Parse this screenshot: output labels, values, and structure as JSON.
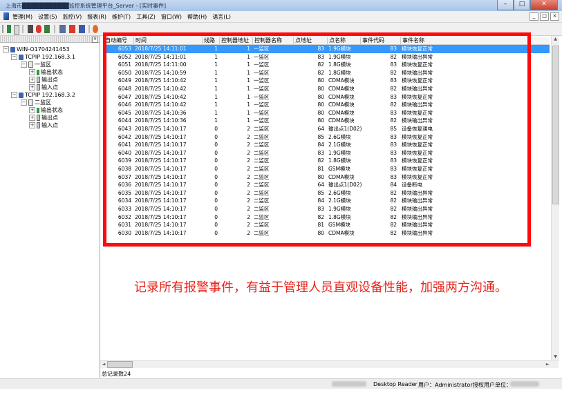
{
  "window": {
    "title": "上海市███████████监控系统管理平台_Server - [实时事件]",
    "btn_min": "–",
    "btn_max": "□",
    "btn_close": "✕"
  },
  "menu": [
    "管理(M)",
    "设置(S)",
    "监控(V)",
    "报表(R)",
    "维护(T)",
    "工具(Z)",
    "窗口(W)",
    "帮助(H)",
    "语言(L)"
  ],
  "mdi_buttons": [
    "_",
    "□",
    "×"
  ],
  "tree": {
    "root": "WIN-O1704241453",
    "groups": [
      {
        "ip": "TCPIP 192.168.3.1",
        "area": "一监区",
        "items": [
          "输出状态",
          "输出点",
          "输入点"
        ]
      },
      {
        "ip": "TCPIP 192.168.3.2",
        "area": "二监区",
        "items": [
          "输出状态",
          "输出点",
          "输入点"
        ]
      }
    ]
  },
  "table": {
    "columns": [
      "自动编号",
      "时间",
      "线路",
      "控制器地址",
      "控制器名称",
      "点地址",
      "点名称",
      "事件代码",
      "事件名称"
    ],
    "rows": [
      [
        "6053",
        "2018/7/25 14:11:01",
        "1",
        "1",
        "一监区",
        "83",
        "1.9G模块",
        "83",
        "模块恢复正常"
      ],
      [
        "6052",
        "2018/7/25 14:11:01",
        "1",
        "1",
        "一监区",
        "83",
        "1.9G模块",
        "82",
        "模块输出异常"
      ],
      [
        "6051",
        "2018/7/25 14:11:00",
        "1",
        "1",
        "一监区",
        "82",
        "1.8G模块",
        "83",
        "模块恢复正常"
      ],
      [
        "6050",
        "2018/7/25 14:10:59",
        "1",
        "1",
        "一监区",
        "82",
        "1.8G模块",
        "82",
        "模块输出异常"
      ],
      [
        "6049",
        "2018/7/25 14:10:42",
        "1",
        "1",
        "一监区",
        "80",
        "CDMA模块",
        "83",
        "模块恢复正常"
      ],
      [
        "6048",
        "2018/7/25 14:10:42",
        "1",
        "1",
        "一监区",
        "80",
        "CDMA模块",
        "82",
        "模块输出异常"
      ],
      [
        "6047",
        "2018/7/25 14:10:42",
        "1",
        "1",
        "一监区",
        "80",
        "CDMA模块",
        "83",
        "模块恢复正常"
      ],
      [
        "6046",
        "2018/7/25 14:10:42",
        "1",
        "1",
        "一监区",
        "80",
        "CDMA模块",
        "82",
        "模块输出异常"
      ],
      [
        "6045",
        "2018/7/25 14:10:36",
        "1",
        "1",
        "一监区",
        "80",
        "CDMA模块",
        "83",
        "模块恢复正常"
      ],
      [
        "6044",
        "2018/7/25 14:10:36",
        "1",
        "1",
        "一监区",
        "80",
        "CDMA模块",
        "82",
        "模块输出异常"
      ],
      [
        "6043",
        "2018/7/25 14:10:17",
        "0",
        "2",
        "二监区",
        "64",
        "输出点1(D02)",
        "85",
        "设备恢复通电"
      ],
      [
        "6042",
        "2018/7/25 14:10:17",
        "0",
        "2",
        "二监区",
        "85",
        "2.6G模块",
        "83",
        "模块恢复正常"
      ],
      [
        "6041",
        "2018/7/25 14:10:17",
        "0",
        "2",
        "二监区",
        "84",
        "2.1G模块",
        "83",
        "模块恢复正常"
      ],
      [
        "6040",
        "2018/7/25 14:10:17",
        "0",
        "2",
        "二监区",
        "83",
        "1.9G模块",
        "83",
        "模块恢复正常"
      ],
      [
        "6039",
        "2018/7/25 14:10:17",
        "0",
        "2",
        "二监区",
        "82",
        "1.8G模块",
        "83",
        "模块恢复正常"
      ],
      [
        "6038",
        "2018/7/25 14:10:17",
        "0",
        "2",
        "二监区",
        "81",
        "GSM模块",
        "83",
        "模块恢复正常"
      ],
      [
        "6037",
        "2018/7/25 14:10:17",
        "0",
        "2",
        "二监区",
        "80",
        "CDMA模块",
        "83",
        "模块恢复正常"
      ],
      [
        "6036",
        "2018/7/25 14:10:17",
        "0",
        "2",
        "二监区",
        "64",
        "输出点1(D02)",
        "84",
        "设备断电"
      ],
      [
        "6035",
        "2018/7/25 14:10:17",
        "0",
        "2",
        "二监区",
        "85",
        "2.6G模块",
        "82",
        "模块输出异常"
      ],
      [
        "6034",
        "2018/7/25 14:10:17",
        "0",
        "2",
        "二监区",
        "84",
        "2.1G模块",
        "82",
        "模块输出异常"
      ],
      [
        "6033",
        "2018/7/25 14:10:17",
        "0",
        "2",
        "二监区",
        "83",
        "1.9G模块",
        "82",
        "模块输出异常"
      ],
      [
        "6032",
        "2018/7/25 14:10:17",
        "0",
        "2",
        "二监区",
        "82",
        "1.8G模块",
        "82",
        "模块输出异常"
      ],
      [
        "6031",
        "2018/7/25 14:10:17",
        "0",
        "2",
        "二监区",
        "81",
        "GSM模块",
        "82",
        "模块输出异常"
      ],
      [
        "6030",
        "2018/7/25 14:10:17",
        "0",
        "2",
        "二监区",
        "80",
        "CDMA模块",
        "82",
        "模块输出异常"
      ]
    ]
  },
  "total_records": "总记录数24",
  "status": {
    "reader": "Desktop Reader",
    "user": "用户：Administrator",
    "licensed_to": "授权用户单位：",
    "left_blurred": "",
    "right_blurred": ""
  },
  "caption": "记录所有报警事件，有益于管理人员直观设备性能，加强两方沟通。",
  "colors": {
    "highlight": "#ff0a0a",
    "selection": "#3399ff",
    "caption": "#e8251d"
  }
}
